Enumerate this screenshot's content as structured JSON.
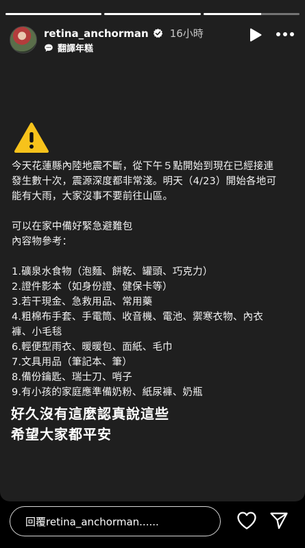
{
  "story": {
    "progress": [
      {
        "fill": 1.0
      },
      {
        "fill": 1.0
      },
      {
        "fill": 0.6
      }
    ],
    "background": "#1f1f1f"
  },
  "header": {
    "username": "retina_anchorman",
    "time": "16小時",
    "subtitle": "翻譯年糕",
    "controls": [
      "play-icon",
      "more-icon"
    ]
  },
  "content": {
    "warning_icon": "warning-icon",
    "intro": [
      "今天花蓮縣內陸地震不斷，從下午５點開始到現在已經接連",
      "發生數十次，震源深度都非常淺。明天（4/23）開始各地可",
      "能有大雨，大家沒事不要前往山區。"
    ],
    "prep": [
      "可以在家中備好緊急避難包",
      "內容物參考："
    ],
    "items": [
      "1.礦泉水食物（泡麵、餅乾、罐頭、巧克力）",
      "2.證件影本（如身份證、健保卡等）",
      "3.若干現金、急救用品、常用藥",
      "4.粗棉布手套、手電筒、收音機、電池、禦寒衣物、內衣",
      "褲、小毛毯",
      "6.輕便型雨衣、暖暖包、面紙、毛巾",
      "7.文具用品（筆記本、筆）",
      "8.備份鑰匙、瑞士刀、哨子",
      "9.有小孩的家庭應準備奶粉、紙尿褲、奶瓶"
    ],
    "headline": [
      "好久沒有這麼認真說這些",
      "希望大家都平安"
    ]
  },
  "footer": {
    "reply_placeholder": "回覆retina_anchorman......",
    "actions": [
      "heart-icon",
      "send-icon"
    ]
  }
}
